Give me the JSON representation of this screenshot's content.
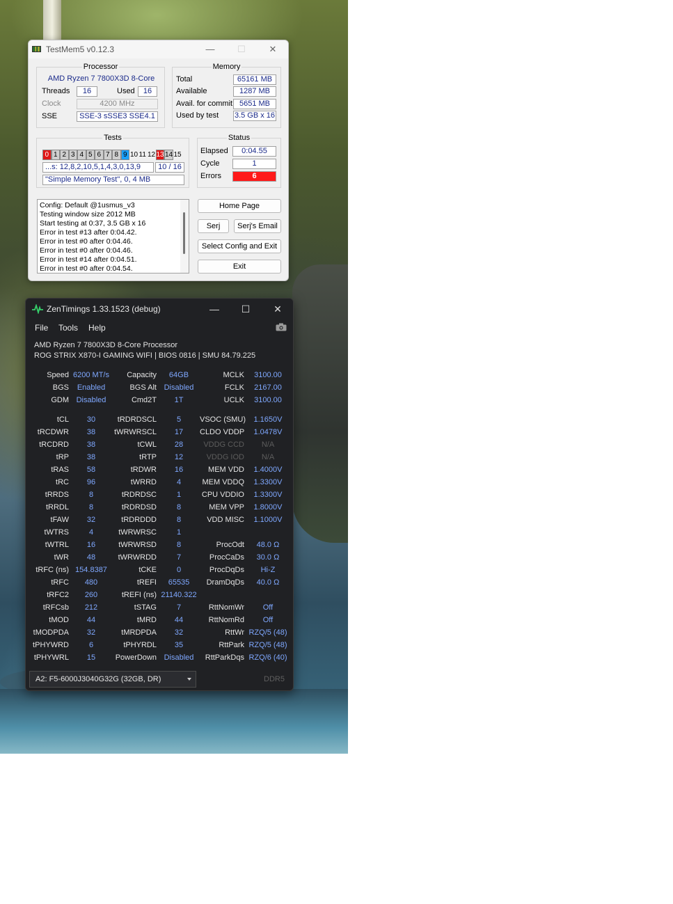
{
  "testmem5": {
    "title": "TestMem5 v0.12.3",
    "window_buttons": [
      "—",
      "☐",
      "✕"
    ],
    "processor": {
      "group_label": "Processor",
      "name": "AMD Ryzen 7 7800X3D 8-Core",
      "threads_label": "Threads",
      "threads": "16",
      "used_label": "Used",
      "used": "16",
      "clock_label": "Clock",
      "clock": "4200 MHz",
      "sse_label": "SSE",
      "sse": "SSE-3 sSSE3 SSE4.1"
    },
    "memory": {
      "group_label": "Memory",
      "total_label": "Total",
      "total": "65161 MB",
      "available_label": "Available",
      "available": "1287 MB",
      "commit_label": "Avail. for commit",
      "commit": "5651 MB",
      "used_label": "Used by test",
      "used": "3.5 GB x 16"
    },
    "tests": {
      "group_label": "Tests",
      "cells": [
        {
          "n": "0",
          "state": "err"
        },
        {
          "n": "1",
          "state": "done"
        },
        {
          "n": "2",
          "state": "done"
        },
        {
          "n": "3",
          "state": "done"
        },
        {
          "n": "4",
          "state": "done"
        },
        {
          "n": "5",
          "state": "done"
        },
        {
          "n": "6",
          "state": "done"
        },
        {
          "n": "7",
          "state": "done"
        },
        {
          "n": "8",
          "state": "done"
        },
        {
          "n": "9",
          "state": "cur"
        },
        {
          "n": "10",
          "state": "plain"
        },
        {
          "n": "11",
          "state": "plain"
        },
        {
          "n": "12",
          "state": "plain"
        },
        {
          "n": "13",
          "state": "err"
        },
        {
          "n": "14",
          "state": "done"
        },
        {
          "n": "15",
          "state": "plain"
        }
      ],
      "sequence": "...s: 12,8,2,10,5,1,4,3,0,13,9",
      "progress": "10 / 16",
      "current": "\"Simple Memory Test\", 0, 4 MB"
    },
    "status": {
      "group_label": "Status",
      "elapsed_label": "Elapsed",
      "elapsed": "0:04.55",
      "cycle_label": "Cycle",
      "cycle": "1",
      "errors_label": "Errors",
      "errors": "6",
      "errors_color": "#ff1a1a"
    },
    "log": [
      "Config: Default @1usmus_v3",
      "Testing window size 2012 MB",
      "Start testing at 0:37, 3.5 GB x 16",
      "Error in test #13 after 0:04.42.",
      "Error in test #0 after 0:04.46.",
      "Error in test #0 after 0:04.46.",
      "Error in test #14 after 0:04.51.",
      "Error in test #0 after 0:04.54."
    ],
    "buttons": {
      "home": "Home Page",
      "serj": "Serj",
      "email": "Serj's Email",
      "config": "Select Config and Exit",
      "exit": "Exit"
    }
  },
  "zentimings": {
    "title": "ZenTimings 1.33.1523 (debug)",
    "window_buttons": [
      "—",
      "☐",
      "✕"
    ],
    "menu": [
      "File",
      "Tools",
      "Help"
    ],
    "cpu": "AMD Ryzen 7 7800X3D 8-Core Processor",
    "board": "ROG STRIX X870-I GAMING WIFI | BIOS 0816 | SMU 84.79.225",
    "top": [
      [
        "Speed",
        "6200 MT/s",
        "Capacity",
        "64GB",
        "MCLK",
        "3100.00"
      ],
      [
        "BGS",
        "Enabled",
        "BGS Alt",
        "Disabled",
        "FCLK",
        "2167.00"
      ],
      [
        "GDM",
        "Disabled",
        "Cmd2T",
        "1T",
        "UCLK",
        "3100.00"
      ]
    ],
    "rows": [
      [
        "tCL",
        "30",
        "tRDRDSCL",
        "5",
        "VSOC (SMU)",
        "1.1650V"
      ],
      [
        "tRCDWR",
        "38",
        "tWRWRSCL",
        "17",
        "CLDO VDDP",
        "1.0478V"
      ],
      [
        "tRCDRD",
        "38",
        "tCWL",
        "28",
        "VDDG CCD",
        "N/A"
      ],
      [
        "tRP",
        "38",
        "tRTP",
        "12",
        "VDDG IOD",
        "N/A"
      ],
      [
        "tRAS",
        "58",
        "tRDWR",
        "16",
        "MEM VDD",
        "1.4000V"
      ],
      [
        "tRC",
        "96",
        "tWRRD",
        "4",
        "MEM VDDQ",
        "1.3300V"
      ],
      [
        "tRRDS",
        "8",
        "tRDRDSC",
        "1",
        "CPU VDDIO",
        "1.3300V"
      ],
      [
        "tRRDL",
        "8",
        "tRDRDSD",
        "8",
        "MEM VPP",
        "1.8000V"
      ],
      [
        "tFAW",
        "32",
        "tRDRDDD",
        "8",
        "VDD MISC",
        "1.1000V"
      ],
      [
        "tWTRS",
        "4",
        "tWRWRSC",
        "1",
        "",
        ""
      ],
      [
        "tWTRL",
        "16",
        "tWRWRSD",
        "8",
        "ProcOdt",
        "48.0 Ω"
      ],
      [
        "tWR",
        "48",
        "tWRWRDD",
        "7",
        "ProcCaDs",
        "30.0 Ω"
      ],
      [
        "tRFC (ns)",
        "154.8387",
        "tCKE",
        "0",
        "ProcDqDs",
        "Hi-Z"
      ],
      [
        "tRFC",
        "480",
        "tREFI",
        "65535",
        "DramDqDs",
        "40.0 Ω"
      ],
      [
        "tRFC2",
        "260",
        "tREFI (ns)",
        "21140.322",
        "",
        ""
      ],
      [
        "tRFCsb",
        "212",
        "tSTAG",
        "7",
        "RttNomWr",
        "Off"
      ],
      [
        "tMOD",
        "44",
        "tMRD",
        "44",
        "RttNomRd",
        "Off"
      ],
      [
        "tMODPDA",
        "32",
        "tMRDPDA",
        "32",
        "RttWr",
        "RZQ/5 (48)"
      ],
      [
        "tPHYWRD",
        "6",
        "tPHYRDL",
        "35",
        "RttPark",
        "RZQ/5 (48)"
      ],
      [
        "tPHYWRL",
        "15",
        "PowerDown",
        "Disabled",
        "RttParkDqs",
        "RZQ/6 (40)"
      ]
    ],
    "dimmed_labels": [
      "VDDG CCD",
      "VDDG IOD"
    ],
    "dimm_select": "A2: F5-6000J3040G32G (32GB, DR)",
    "mem_type": "DDR5",
    "accent_color": "#7fa8ff"
  }
}
